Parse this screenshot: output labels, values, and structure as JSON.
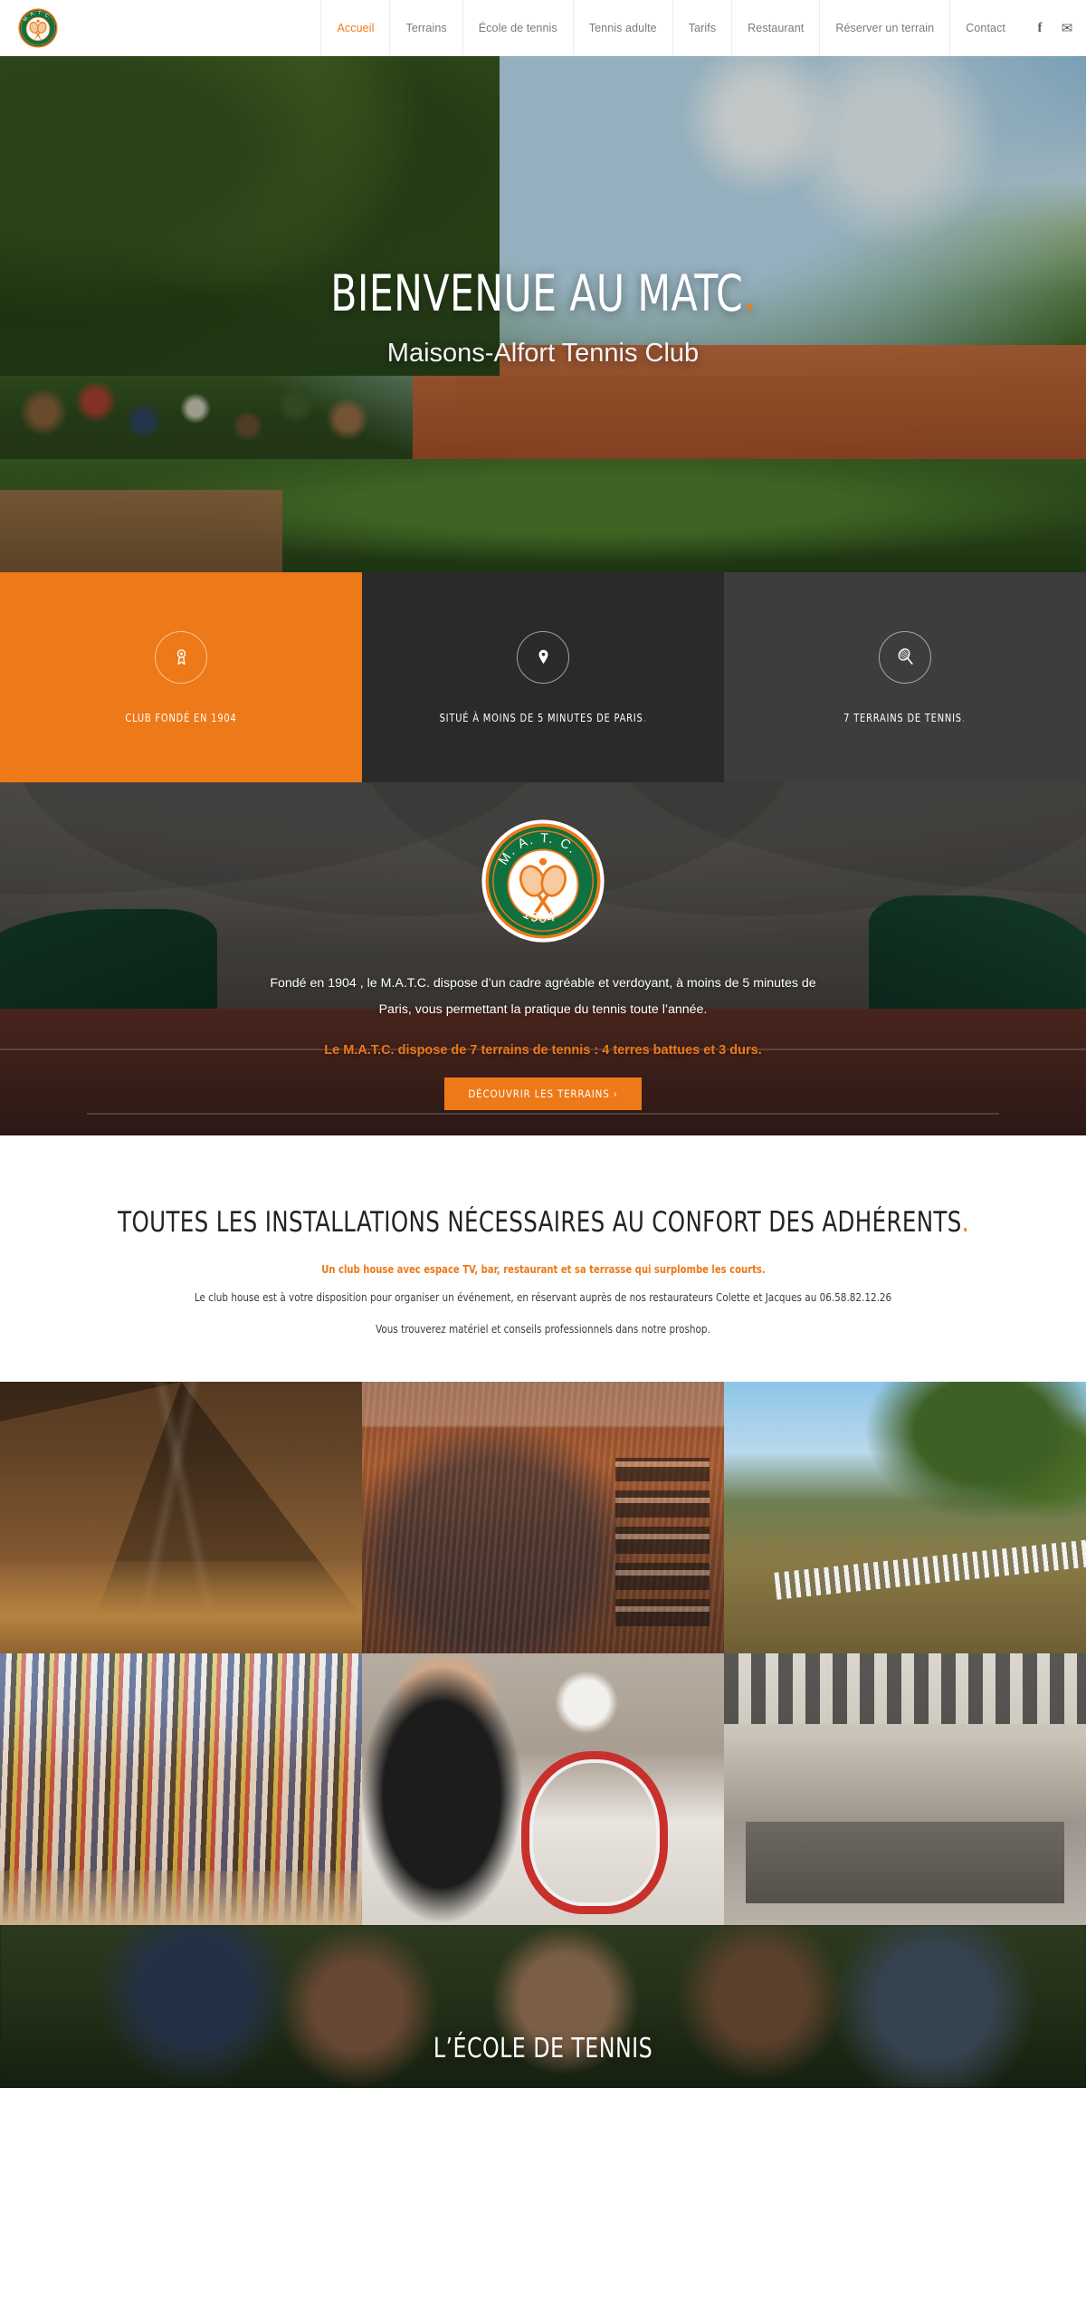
{
  "header": {
    "logo_alt": "M.A.T.C. 1904",
    "nav": [
      {
        "label": "Accueil",
        "active": true
      },
      {
        "label": "Terrains",
        "active": false
      },
      {
        "label": "École de tennis",
        "active": false
      },
      {
        "label": "Tennis adulte",
        "active": false
      },
      {
        "label": "Tarifs",
        "active": false
      },
      {
        "label": "Restaurant",
        "active": false
      },
      {
        "label": "Réserver un terrain",
        "active": false
      },
      {
        "label": "Contact",
        "active": false
      }
    ],
    "social": [
      {
        "icon": "facebook-icon",
        "glyph": "f"
      },
      {
        "icon": "email-icon",
        "glyph": "✉"
      }
    ]
  },
  "hero": {
    "title": "BIENVENUE AU MATC",
    "title_dot": ".",
    "subtitle": "Maisons-Alfort Tennis Club"
  },
  "features": [
    {
      "icon": "award-ribbon-icon",
      "label": "CLUB FONDÉ EN 1904",
      "dot": "",
      "bg": "#ee7918"
    },
    {
      "icon": "map-pin-icon",
      "label": "SITUÉ À MOINS DE 5 MINUTES DE PARIS",
      "dot": ".",
      "bg": "#2a2a2a"
    },
    {
      "icon": "tennis-racket-icon",
      "label": "7 TERRAINS DE TENNIS",
      "dot": ".",
      "bg": "#3d3d3d"
    }
  ],
  "about": {
    "logo_top_text": "M. A. T. C.",
    "logo_year": "1904",
    "paragraph": "Fondé en 1904 , le M.A.T.C. dispose d’un cadre agréable et verdoyant, à moins de 5 minutes de Paris, vous permettant la pratique du tennis toute l’année.",
    "highlight": "Le M.A.T.C. dispose de 7 terrains de tennis : 4 terres battues et 3 durs.",
    "button_label": "DÉCOUVRIR LES TERRAINS  ›"
  },
  "installations": {
    "heading": "TOUTES LES INSTALLATIONS NÉCESSAIRES AU CONFORT DES ADHÉRENTS",
    "heading_dot": ".",
    "subheading": "Un club house avec espace TV, bar, restaurant et sa terrasse qui surplombe les courts.",
    "line1": "Le club house est à votre disposition pour organiser un événement, en réservant auprès de nos restaurateurs Colette et Jacques au 06.58.82.12.26",
    "line2": "Vous trouverez matériel et conseils professionnels dans notre proshop."
  },
  "gallery": [
    {
      "name": "clubhouse-roof-beams-photo"
    },
    {
      "name": "clubhouse-banquet-hall-photo"
    },
    {
      "name": "terrace-overlooking-courts-photo"
    },
    {
      "name": "proshop-rackets-wall-photo"
    },
    {
      "name": "racket-stringing-workshop-photo"
    },
    {
      "name": "clubhouse-bar-photo"
    }
  ],
  "ecole": {
    "title": "L’ÉCOLE DE TENNIS"
  },
  "colors": {
    "accent": "#ee7918",
    "dark": "#2a2a2a",
    "dark_light": "#3d3d3d",
    "green": "#11703f"
  }
}
